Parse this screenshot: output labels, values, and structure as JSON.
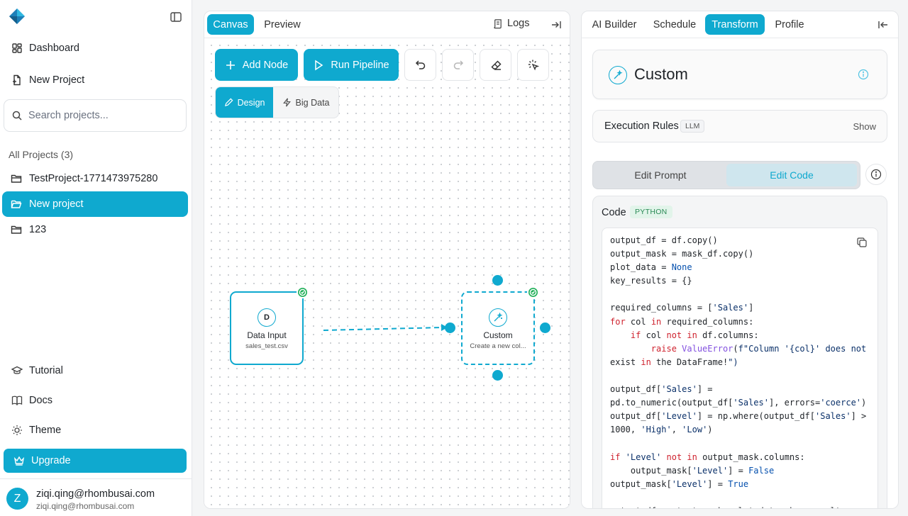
{
  "sidebar": {
    "nav": {
      "dashboard": "Dashboard",
      "new_project": "New Project"
    },
    "search_placeholder": "Search projects...",
    "all_projects": "All Projects (3)",
    "projects": [
      {
        "name": "TestProject-1771473975280",
        "active": false
      },
      {
        "name": "New project",
        "active": true
      },
      {
        "name": "123",
        "active": false
      }
    ],
    "footer_nav": {
      "tutorial": "Tutorial",
      "docs": "Docs",
      "theme": "Theme",
      "upgrade": "Upgrade"
    },
    "user": {
      "initial": "Z",
      "name": "ziqi.qing@rhombusai.com",
      "email": "ziqi.qing@rhombusai.com"
    }
  },
  "canvas": {
    "tabs": {
      "canvas": "Canvas",
      "preview": "Preview"
    },
    "logs": "Logs",
    "toolbar": {
      "add_node": "Add Node",
      "run_pipeline": "Run Pipeline"
    },
    "modes": {
      "design": "Design",
      "big_data": "Big Data"
    },
    "nodes": {
      "input": {
        "icon_letter": "D",
        "title": "Data Input",
        "subtitle": "sales_test.csv"
      },
      "custom": {
        "title": "Custom",
        "subtitle": "Create a new col..."
      }
    }
  },
  "right_panel": {
    "tabs": {
      "ai_builder": "AI Builder",
      "schedule": "Schedule",
      "transform": "Transform",
      "profile": "Profile"
    },
    "active_tab": "Transform",
    "node_title": "Custom",
    "execution_rules": {
      "label": "Execution Rules",
      "badge": "LLM",
      "toggle": "Show"
    },
    "segment": {
      "edit_prompt": "Edit Prompt",
      "edit_code": "Edit Code",
      "active": "Edit Code"
    },
    "code": {
      "label": "Code",
      "language": "PYTHON",
      "lines": [
        "output_df = df.copy()",
        "output_mask = mask_df.copy()",
        "plot_data = None",
        "key_results = {}",
        "",
        "required_columns = ['Sales']",
        "for col in required_columns:",
        "    if col not in df.columns:",
        "        raise ValueError(f\"Column '{col}' does not",
        "exist in the DataFrame!\")",
        "",
        "output_df['Sales'] =",
        "pd.to_numeric(output_df['Sales'], errors='coerce')",
        "output_df['Level'] = np.where(output_df['Sales'] >",
        "1000, 'High', 'Low')",
        "",
        "if 'Level' not in output_mask.columns:",
        "    output_mask['Level'] = False",
        "output_mask['Level'] = True",
        "",
        "output_df, output_mask, plot_data, key_results"
      ]
    }
  },
  "colors": {
    "accent": "#0fa9cf",
    "success": "#22b05a",
    "code_badge_bg": "#e2f4ea"
  }
}
